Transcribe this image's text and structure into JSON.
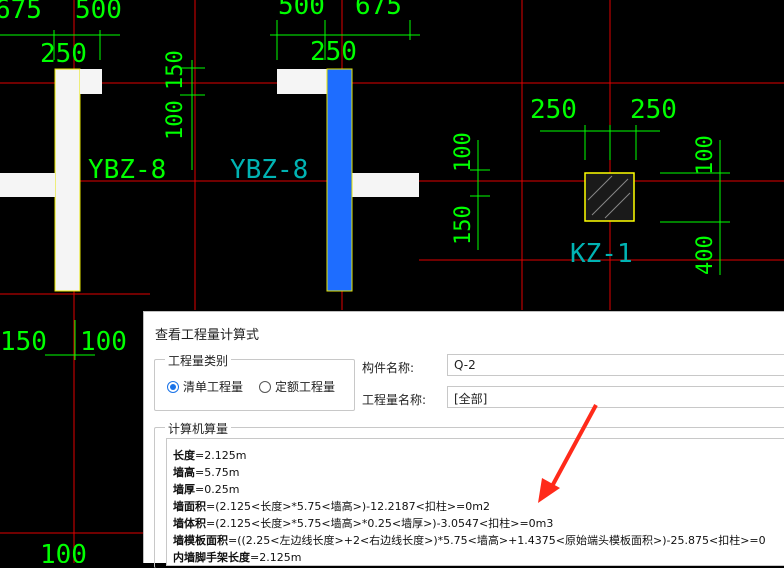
{
  "cad": {
    "labels": {
      "dim_675_top_left": "675",
      "dim_500_top_left": "500",
      "dim_500_top_mid": "500",
      "dim_675_top_mid": "675",
      "dim_250_left": "250",
      "dim_250_mid": "250",
      "dim_150_vert": "150",
      "dim_100_vert": "100",
      "ybz_left": "YBZ-8",
      "ybz_right": "YBZ-8",
      "dim_250_right_a": "250",
      "dim_250_right_b": "250",
      "dim_100_right_a": "100",
      "dim_150_right": "150",
      "kz_label": "KZ-1",
      "dim_100_far_right": "100",
      "dim_400_far_right": "400",
      "dim_150_bottom_left": "150",
      "dim_100_bottom_left": "100",
      "dim_100_bottom": "100"
    },
    "colors": {
      "grid": "#ff0000",
      "dimension": "#00ff00",
      "component_label": "#00aaaa",
      "wall_fill": "#f5f5f5",
      "selected_wall": "#1e6dff",
      "column_outline": "#ffff00"
    }
  },
  "dialog": {
    "title": "查看工程量计算式",
    "qty_type_group": "工程量类别",
    "radio_list": "清单工程量",
    "radio_quota": "定额工程量",
    "radio_selected": "清单工程量",
    "component_name_label": "构件名称:",
    "component_name_value": "Q-2",
    "qty_name_label": "工程量名称:",
    "qty_name_value": "[全部]",
    "calc_group": "计算机算量",
    "lines": [
      {
        "key": "长度",
        "text": "=2.125m"
      },
      {
        "key": "墙高",
        "text": "=5.75m"
      },
      {
        "key": "墙厚",
        "text": "=0.25m"
      },
      {
        "key": "墙面积",
        "text": "=(2.125<长度>*5.75<墙高>)-12.2187<扣柱>=0m2"
      },
      {
        "key": "墙体积",
        "text": "=(2.125<长度>*5.75<墙高>*0.25<墙厚>)-3.0547<扣柱>=0m3"
      },
      {
        "key": "墙模板面积",
        "text": "=((2.25<左边线长度>+2<右边线长度>)*5.75<墙高>+1.4375<原始端头模板面积>)-25.875<扣柱>=0"
      },
      {
        "key": "内墙脚手架长度",
        "text": "=2.125m"
      }
    ]
  },
  "annotation": {
    "arrow_color": "#ff2a1a"
  }
}
